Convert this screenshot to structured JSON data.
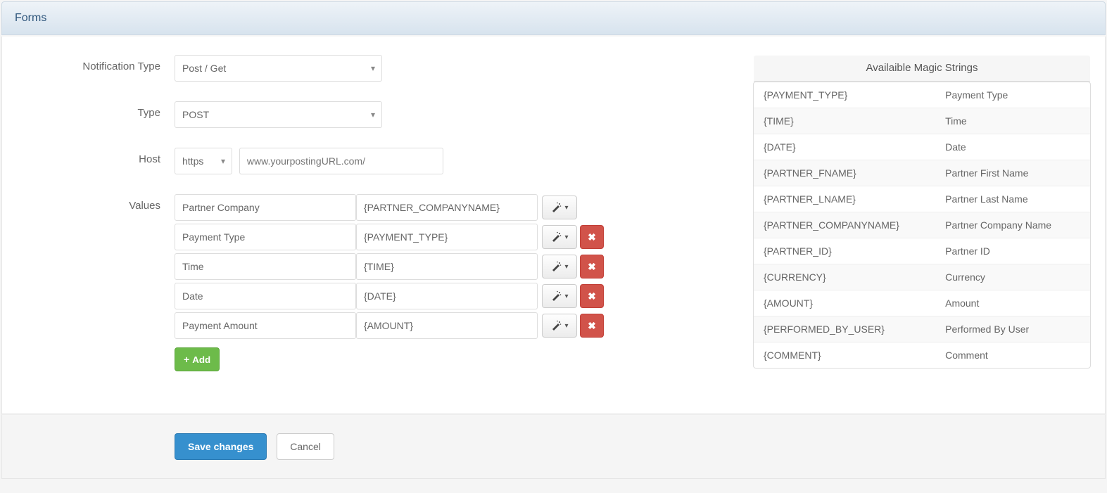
{
  "header": {
    "title": "Forms"
  },
  "form": {
    "notification_type": {
      "label": "Notification Type",
      "value": "Post / Get"
    },
    "type": {
      "label": "Type",
      "value": "POST"
    },
    "host": {
      "label": "Host",
      "protocol": "https",
      "placeholder": "www.yourpostingURL.com/",
      "value": ""
    },
    "values_label": "Values",
    "values": [
      {
        "name": "Partner Company",
        "value": "{PARTNER_COMPANYNAME}",
        "deletable": false
      },
      {
        "name": "Payment Type",
        "value": "{PAYMENT_TYPE}",
        "deletable": true
      },
      {
        "name": "Time",
        "value": "{TIME}",
        "deletable": true
      },
      {
        "name": "Date",
        "value": "{DATE}",
        "deletable": true
      },
      {
        "name": "Payment Amount",
        "value": "{AMOUNT}",
        "deletable": true
      }
    ],
    "add_label": "Add"
  },
  "magic": {
    "title": "Availaible Magic Strings",
    "items": [
      {
        "token": "{PAYMENT_TYPE}",
        "desc": "Payment Type"
      },
      {
        "token": "{TIME}",
        "desc": "Time"
      },
      {
        "token": "{DATE}",
        "desc": "Date"
      },
      {
        "token": "{PARTNER_FNAME}",
        "desc": "Partner First Name"
      },
      {
        "token": "{PARTNER_LNAME}",
        "desc": "Partner Last Name"
      },
      {
        "token": "{PARTNER_COMPANYNAME}",
        "desc": "Partner Company Name"
      },
      {
        "token": "{PARTNER_ID}",
        "desc": "Partner ID"
      },
      {
        "token": "{CURRENCY}",
        "desc": "Currency"
      },
      {
        "token": "{AMOUNT}",
        "desc": "Amount"
      },
      {
        "token": "{PERFORMED_BY_USER}",
        "desc": "Performed By User"
      },
      {
        "token": "{COMMENT}",
        "desc": "Comment"
      }
    ]
  },
  "footer": {
    "save_label": "Save changes",
    "cancel_label": "Cancel"
  }
}
